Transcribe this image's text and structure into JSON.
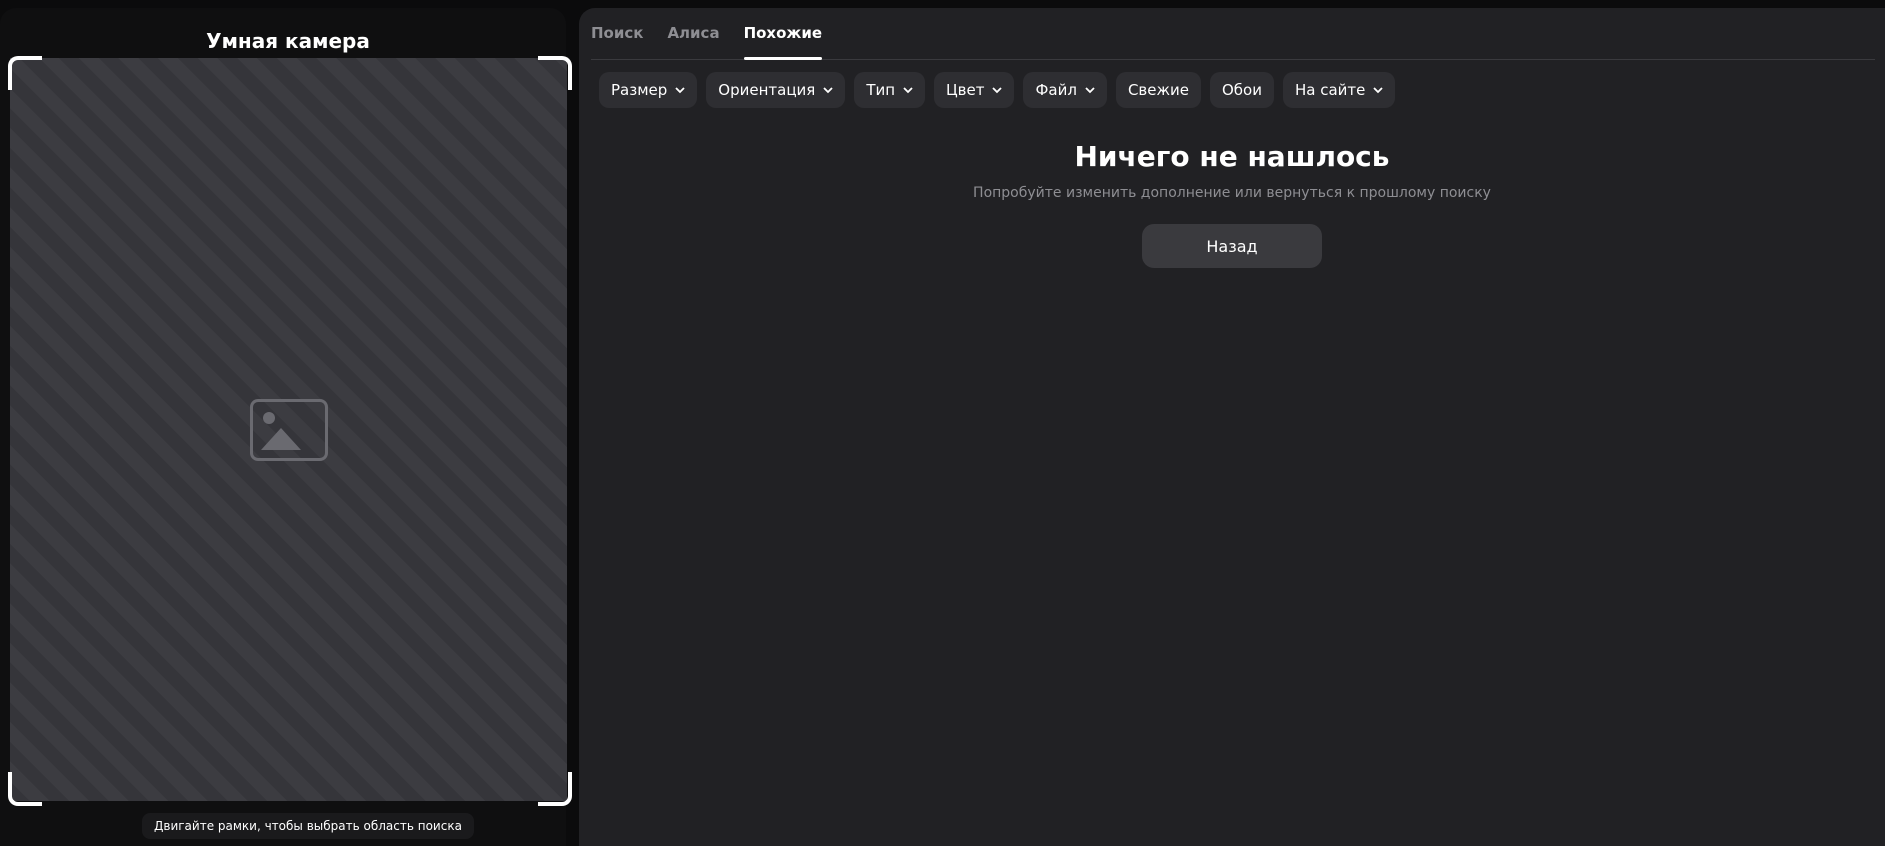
{
  "camera": {
    "title": "Умная камера",
    "hint": "Двигайте рамки, чтобы выбрать область поиска"
  },
  "tabs": [
    {
      "label": "Поиск",
      "active": false
    },
    {
      "label": "Алиса",
      "active": false
    },
    {
      "label": "Похожие",
      "active": true
    }
  ],
  "filters": [
    {
      "label": "Размер",
      "dropdown": true
    },
    {
      "label": "Ориентация",
      "dropdown": true
    },
    {
      "label": "Тип",
      "dropdown": true
    },
    {
      "label": "Цвет",
      "dropdown": true
    },
    {
      "label": "Файл",
      "dropdown": true
    },
    {
      "label": "Свежие",
      "dropdown": false
    },
    {
      "label": "Обои",
      "dropdown": false
    },
    {
      "label": "На сайте",
      "dropdown": true
    }
  ],
  "empty_state": {
    "title": "Ничего не нашлось",
    "subtitle": "Попробуйте изменить дополнение или вернуться к прошлому поиску",
    "back_label": "Назад"
  },
  "colors": {
    "panel_bg": "#212124",
    "chip_bg": "#2e2e32",
    "button_bg": "#3a3a3e",
    "muted_text": "#8e8e93"
  }
}
